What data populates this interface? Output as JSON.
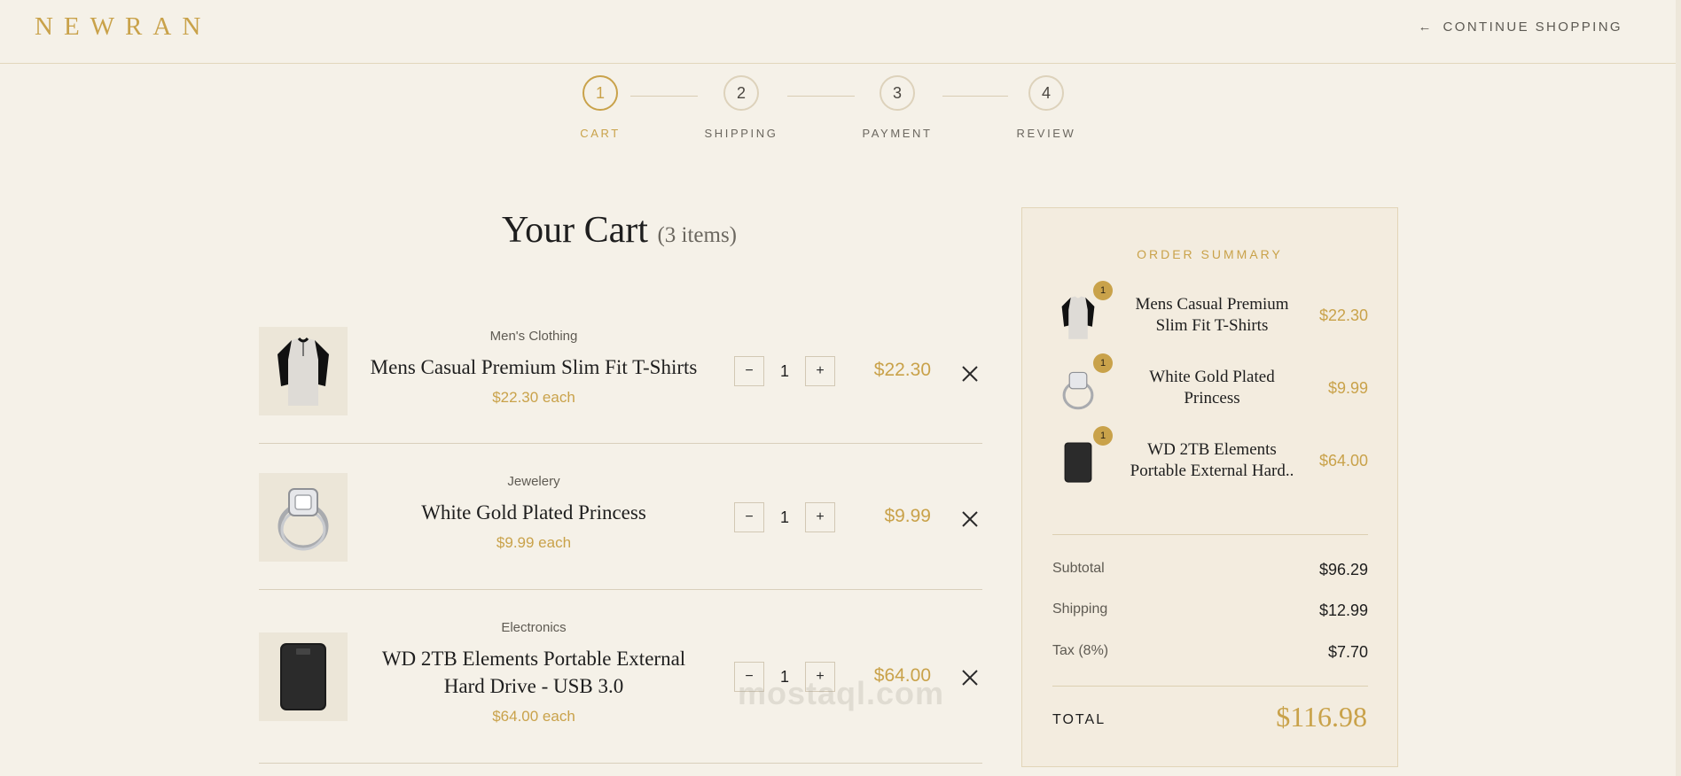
{
  "header": {
    "logo": "NEWRAN",
    "continue_arrow": "←",
    "continue_label": "CONTINUE SHOPPING"
  },
  "steps": [
    {
      "number": "1",
      "label": "CART",
      "active": true
    },
    {
      "number": "2",
      "label": "SHIPPING",
      "active": false
    },
    {
      "number": "3",
      "label": "PAYMENT",
      "active": false
    },
    {
      "number": "4",
      "label": "REVIEW",
      "active": false
    }
  ],
  "cart": {
    "title": "Your Cart",
    "count": "(3 items)",
    "minus_label": "−",
    "plus_label": "+",
    "items": [
      {
        "category": "Men's Clothing",
        "name": "Mens Casual Premium Slim Fit T-Shirts",
        "each": "$22.30 each",
        "quantity": "1",
        "price": "$22.30"
      },
      {
        "category": "Jewelery",
        "name": "White Gold Plated Princess",
        "each": "$9.99 each",
        "quantity": "1",
        "price": "$9.99"
      },
      {
        "category": "Electronics",
        "name": "WD 2TB Elements Portable External Hard Drive - USB 3.0",
        "each": "$64.00 each",
        "quantity": "1",
        "price": "$64.00"
      }
    ]
  },
  "summary": {
    "title": "ORDER SUMMARY",
    "items": [
      {
        "name_line1": "Mens Casual Premium",
        "name_line2": "Slim Fit T-Shirts",
        "badge": "1",
        "price": "$22.30"
      },
      {
        "name_line1": "White Gold Plated",
        "name_line2": "Princess",
        "badge": "1",
        "price": "$9.99"
      },
      {
        "name_line1": "WD 2TB Elements",
        "name_line2": "Portable External Hard..",
        "badge": "1",
        "price": "$64.00"
      }
    ],
    "subtotal_label": "Subtotal",
    "subtotal": "$96.29",
    "shipping_label": "Shipping",
    "shipping": "$12.99",
    "tax_label": "Tax (8%)",
    "tax": "$7.70",
    "total_label": "TOTAL",
    "total": "$116.98"
  },
  "watermark": "mostaql.com",
  "colors": {
    "accent": "#c9a24a",
    "background": "#f5f1e8",
    "text": "#1e1e1e"
  }
}
